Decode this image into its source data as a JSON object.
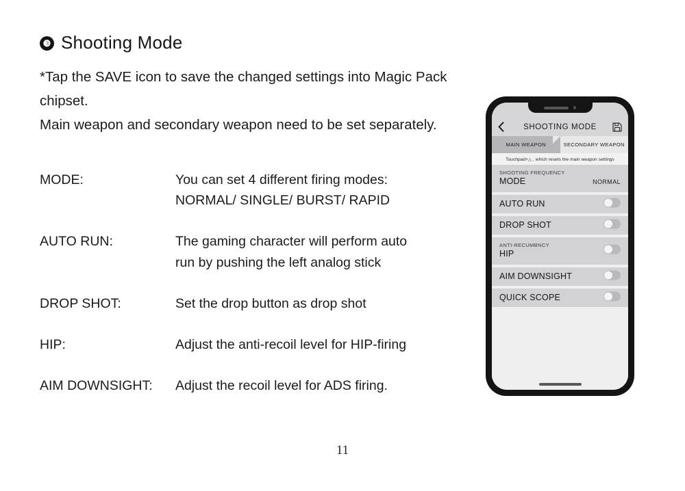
{
  "document": {
    "section_number": "❸",
    "heading": "Shooting Mode",
    "paragraph_1": "*Tap the SAVE icon to save the changed settings into Magic Pack",
    "paragraph_2": "chipset.",
    "paragraph_3": "Main weapon and secondary weapon need to be set separately.",
    "page_number": "11",
    "definitions": [
      {
        "term": "MODE:",
        "desc_line1": "You can set 4 different firing modes:",
        "desc_line2": "NORMAL/ SINGLE/ BURST/ RAPID"
      },
      {
        "term": "AUTO RUN:",
        "desc_line1": "The gaming character will perform auto",
        "desc_line2": "run by pushing the left analog stick"
      },
      {
        "term": "DROP SHOT:",
        "desc_line1": "Set the drop button as drop shot",
        "desc_line2": ""
      },
      {
        "term": "HIP:",
        "desc_line1": "Adjust the anti-recoil level for HIP-firing",
        "desc_line2": ""
      },
      {
        "term": "AIM DOWNSIGHT:",
        "desc_line1": "Adjust the recoil level for ADS firing.",
        "desc_line2": ""
      }
    ]
  },
  "phone": {
    "navbar": {
      "back_icon": "chevron-left-icon",
      "title": "SHOOTING MODE",
      "save_icon": "floppy-disk-save-icon"
    },
    "tabs": [
      {
        "label": "MAIN WEAPON",
        "active": true
      },
      {
        "label": "SECONDARY WEAPON",
        "active": false
      }
    ],
    "hint": "Touchpad+△ , which resets the main weapon settings",
    "settings": [
      {
        "sublabel": "SHOOTING FREQUENCY",
        "label": "MODE",
        "value": "NORMAL",
        "control": "value"
      },
      {
        "sublabel": "",
        "label": "AUTO RUN",
        "value": "",
        "control": "toggle",
        "toggle_state": "off"
      },
      {
        "sublabel": "",
        "label": "DROP SHOT",
        "value": "",
        "control": "toggle",
        "toggle_state": "off"
      },
      {
        "sublabel": "ANTI-RECUMBNCY",
        "label": "HIP",
        "value": "",
        "control": "toggle",
        "toggle_state": "off"
      },
      {
        "sublabel": "",
        "label": "AIM DOWNSIGHT",
        "value": "",
        "control": "toggle",
        "toggle_state": "off"
      },
      {
        "sublabel": "",
        "label": "QUICK SCOPE",
        "value": "",
        "control": "toggle",
        "toggle_state": "off"
      }
    ],
    "colors": {
      "bezel": "#141414",
      "screen_bg": "#efeff0",
      "navbar_bg": "#d6d6d8",
      "tab_active_bg": "#b6b6b8",
      "tab_inactive_bg": "#e8e8e9",
      "row_bg": "#d2d2d4",
      "toggle_track": "#b9b9bb",
      "toggle_knob": "#f4f4f4"
    }
  }
}
